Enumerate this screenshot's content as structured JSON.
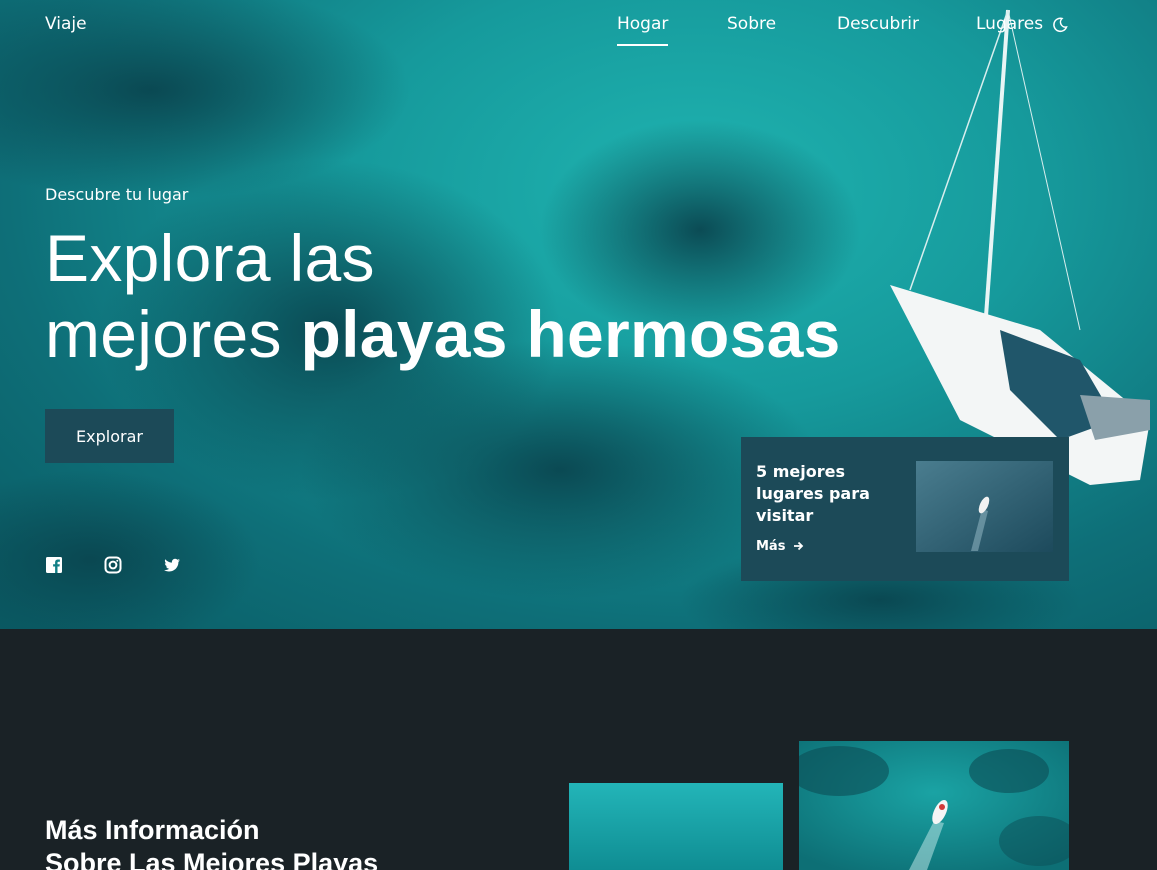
{
  "nav": {
    "logo": "Viaje",
    "links": [
      "Hogar",
      "Sobre",
      "Descubrir",
      "Lugares"
    ],
    "active": "Hogar",
    "theme_icon": "moon-icon"
  },
  "hero": {
    "subtitle": "Descubre tu lugar",
    "title_line1": "Explora las",
    "title_line2_regular": "mejores ",
    "title_line2_bold": "playas hermosas",
    "button": "Explorar",
    "social_icons": [
      "facebook-icon",
      "instagram-icon",
      "twitter-icon"
    ]
  },
  "card": {
    "title": "5 mejores lugares para visitar",
    "more": "Más"
  },
  "info": {
    "heading_line1": "Más Información",
    "heading_line2": "Sobre Las Mejores Playas"
  },
  "colors": {
    "accent": "#1c4a58",
    "dark_bg": "#1a2226",
    "sea": "#169a9c"
  }
}
